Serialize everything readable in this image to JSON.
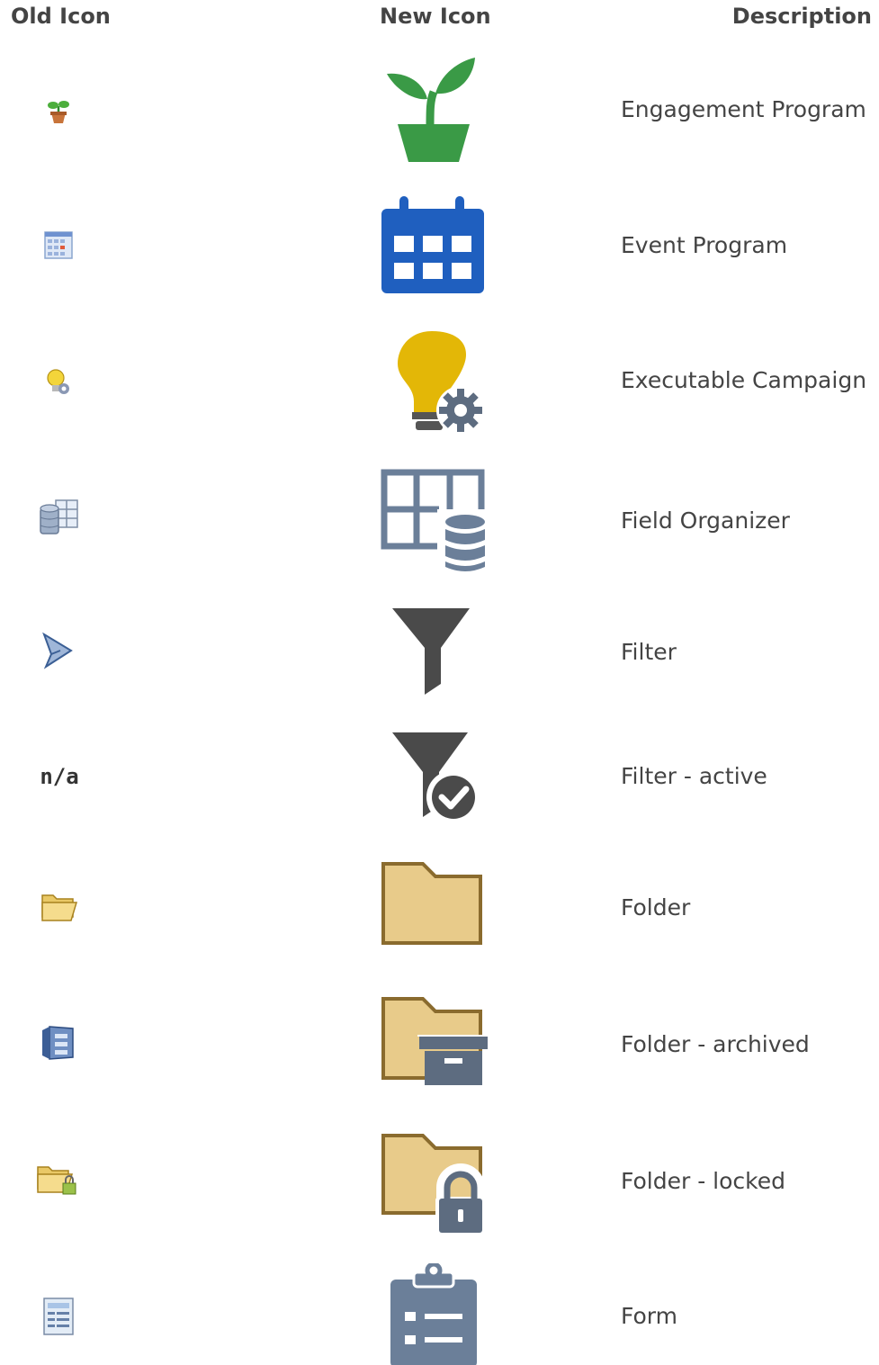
{
  "headers": {
    "old_icon": "Old Icon",
    "new_icon": "New Icon",
    "description": "Description"
  },
  "rows": [
    {
      "old_icon": "small-potted-plant-icon",
      "new_icon": "potted-plant-icon",
      "description": "Engagement Program",
      "color": "#3a9a46"
    },
    {
      "old_icon": "small-calendar-icon",
      "new_icon": "calendar-icon",
      "description": "Event Program",
      "color": "#1f5fbf"
    },
    {
      "old_icon": "small-lightbulb-icon",
      "new_icon": "lightbulb-gear-icon",
      "description": "Executable Campaign",
      "color": "#e3b707"
    },
    {
      "old_icon": "small-database-grid-icon",
      "new_icon": "grid-database-icon",
      "description": "Field Organizer",
      "color": "#6b7f99"
    },
    {
      "old_icon": "small-funnel-icon",
      "new_icon": "funnel-icon",
      "description": "Filter",
      "color": "#4a4a4a"
    },
    {
      "old_icon_text": "n/a",
      "new_icon": "funnel-check-icon",
      "description": "Filter - active",
      "color": "#4a4a4a"
    },
    {
      "old_icon": "small-folder-icon",
      "new_icon": "folder-icon",
      "description": "Folder",
      "color": "#e8cb8a"
    },
    {
      "old_icon": "small-archive-cabinet-icon",
      "new_icon": "folder-archive-icon",
      "description": "Folder - archived",
      "color": "#e8cb8a"
    },
    {
      "old_icon": "small-folder-lock-icon",
      "new_icon": "folder-lock-icon",
      "description": "Folder - locked",
      "color": "#e8cb8a"
    },
    {
      "old_icon": "small-form-icon",
      "new_icon": "clipboard-form-icon",
      "description": "Form",
      "color": "#6b7f99"
    }
  ]
}
